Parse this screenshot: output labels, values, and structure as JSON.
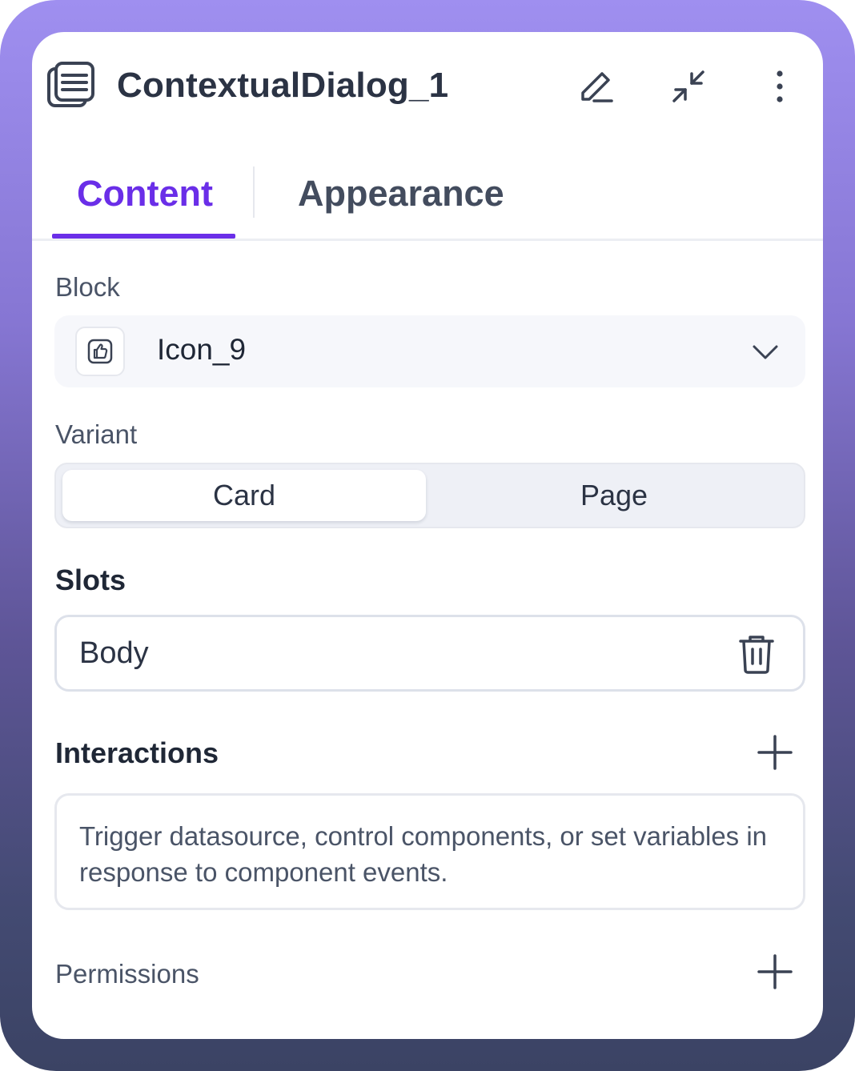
{
  "panel": {
    "title": "ContextualDialog_1",
    "icons": {
      "component": "dialog-stack-icon",
      "edit": "pencil-icon",
      "collapse": "collapse-arrows-icon",
      "more": "kebab-menu-icon"
    }
  },
  "tabs": [
    {
      "label": "Content",
      "active": true
    },
    {
      "label": "Appearance",
      "active": false
    }
  ],
  "block": {
    "label": "Block",
    "value": "Icon_9",
    "icon": "thumbs-up-icon"
  },
  "variant": {
    "label": "Variant",
    "options": [
      "Card",
      "Page"
    ],
    "selected": "Card"
  },
  "slots": {
    "title": "Slots",
    "items": [
      {
        "label": "Body"
      }
    ]
  },
  "interactions": {
    "title": "Interactions",
    "description": "Trigger datasource, control components, or set variables in response to component events."
  },
  "permissions": {
    "title": "Permissions"
  },
  "colors": {
    "accent": "#6a2ee8",
    "text": "#1f2736",
    "muted": "#4a5467"
  }
}
